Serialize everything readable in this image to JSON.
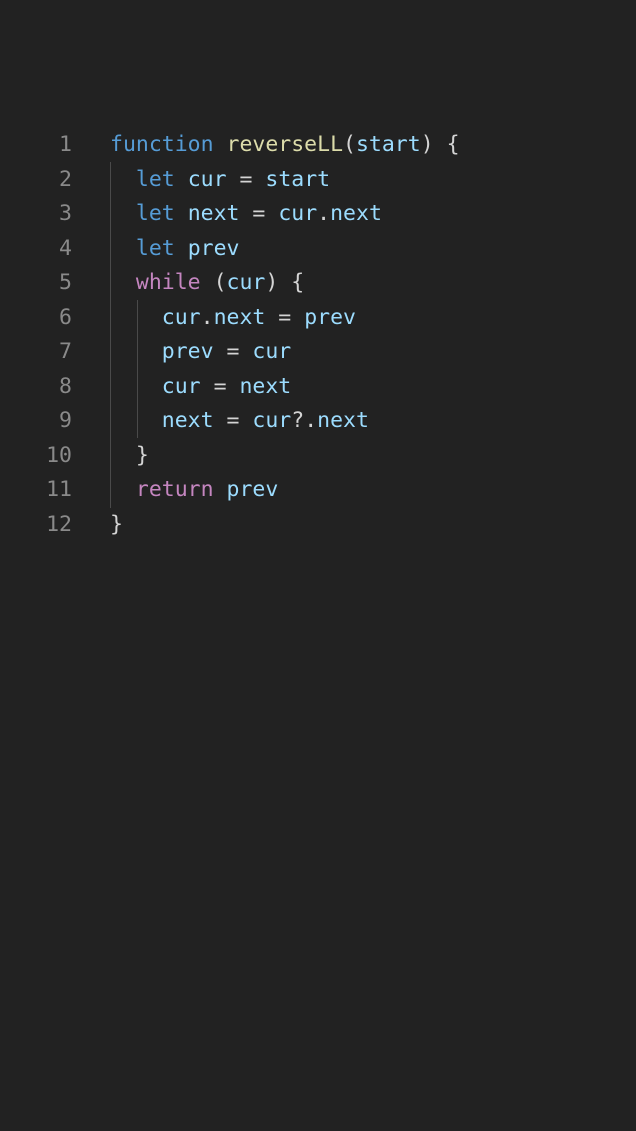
{
  "editor": {
    "lines": [
      {
        "number": "1",
        "tokens": [
          {
            "text": "function",
            "kind": "kw"
          },
          {
            "text": " ",
            "kind": "punc"
          },
          {
            "text": "reverseLL",
            "kind": "fn"
          },
          {
            "text": "(",
            "kind": "punc"
          },
          {
            "text": "start",
            "kind": "var"
          },
          {
            "text": ") {",
            "kind": "punc"
          }
        ]
      },
      {
        "number": "2",
        "tokens": [
          {
            "text": "  ",
            "kind": "punc"
          },
          {
            "text": "let",
            "kind": "kw"
          },
          {
            "text": " ",
            "kind": "punc"
          },
          {
            "text": "cur",
            "kind": "var"
          },
          {
            "text": " = ",
            "kind": "punc"
          },
          {
            "text": "start",
            "kind": "var"
          }
        ]
      },
      {
        "number": "3",
        "tokens": [
          {
            "text": "  ",
            "kind": "punc"
          },
          {
            "text": "let",
            "kind": "kw"
          },
          {
            "text": " ",
            "kind": "punc"
          },
          {
            "text": "next",
            "kind": "var"
          },
          {
            "text": " = ",
            "kind": "punc"
          },
          {
            "text": "cur",
            "kind": "var"
          },
          {
            "text": ".",
            "kind": "punc"
          },
          {
            "text": "next",
            "kind": "var"
          }
        ]
      },
      {
        "number": "4",
        "tokens": [
          {
            "text": "  ",
            "kind": "punc"
          },
          {
            "text": "let",
            "kind": "kw"
          },
          {
            "text": " ",
            "kind": "punc"
          },
          {
            "text": "prev",
            "kind": "var"
          }
        ]
      },
      {
        "number": "5",
        "tokens": [
          {
            "text": "  ",
            "kind": "punc"
          },
          {
            "text": "while",
            "kind": "ctl"
          },
          {
            "text": " (",
            "kind": "punc"
          },
          {
            "text": "cur",
            "kind": "var"
          },
          {
            "text": ") {",
            "kind": "punc"
          }
        ]
      },
      {
        "number": "6",
        "tokens": [
          {
            "text": "    ",
            "kind": "punc"
          },
          {
            "text": "cur",
            "kind": "var"
          },
          {
            "text": ".",
            "kind": "punc"
          },
          {
            "text": "next",
            "kind": "var"
          },
          {
            "text": " = ",
            "kind": "punc"
          },
          {
            "text": "prev",
            "kind": "var"
          }
        ]
      },
      {
        "number": "7",
        "tokens": [
          {
            "text": "    ",
            "kind": "punc"
          },
          {
            "text": "prev",
            "kind": "var"
          },
          {
            "text": " = ",
            "kind": "punc"
          },
          {
            "text": "cur",
            "kind": "var"
          }
        ]
      },
      {
        "number": "8",
        "tokens": [
          {
            "text": "    ",
            "kind": "punc"
          },
          {
            "text": "cur",
            "kind": "var"
          },
          {
            "text": " = ",
            "kind": "punc"
          },
          {
            "text": "next",
            "kind": "var"
          }
        ]
      },
      {
        "number": "9",
        "tokens": [
          {
            "text": "    ",
            "kind": "punc"
          },
          {
            "text": "next",
            "kind": "var"
          },
          {
            "text": " = ",
            "kind": "punc"
          },
          {
            "text": "cur",
            "kind": "var"
          },
          {
            "text": "?.",
            "kind": "punc"
          },
          {
            "text": "next",
            "kind": "var"
          }
        ]
      },
      {
        "number": "10",
        "tokens": [
          {
            "text": "  }",
            "kind": "punc"
          }
        ]
      },
      {
        "number": "11",
        "tokens": [
          {
            "text": "  ",
            "kind": "punc"
          },
          {
            "text": "return",
            "kind": "ctl"
          },
          {
            "text": " ",
            "kind": "punc"
          },
          {
            "text": "prev",
            "kind": "var"
          }
        ]
      },
      {
        "number": "12",
        "tokens": [
          {
            "text": "}",
            "kind": "punc"
          }
        ]
      }
    ]
  },
  "colors": {
    "background": "#222222",
    "line_number": "#8a8a8a",
    "keyword": "#569cd6",
    "function_name": "#dcdcaa",
    "variable": "#9cdcfe",
    "control_keyword": "#c586c0",
    "punctuation": "#d4d4d4",
    "indent_guide": "#4a4a4a"
  }
}
